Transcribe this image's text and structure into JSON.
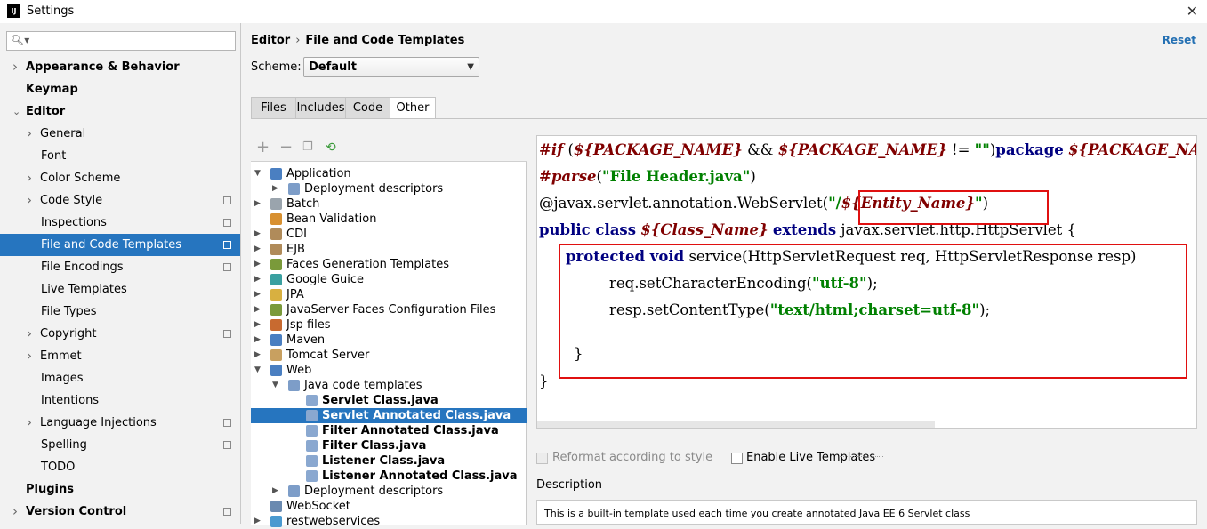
{
  "window": {
    "title": "Settings"
  },
  "search": {
    "placeholder": ""
  },
  "sidebar": {
    "items": [
      {
        "label": "Appearance & Behavior",
        "level": 0,
        "bold": true,
        "arrow": true,
        "selected": false,
        "project": false
      },
      {
        "label": "Keymap",
        "level": 0,
        "bold": true,
        "arrow": false,
        "selected": false,
        "project": false
      },
      {
        "label": "Editor",
        "level": 0,
        "bold": true,
        "arrow": true,
        "expanded": true,
        "selected": false,
        "project": false
      },
      {
        "label": "General",
        "level": 1,
        "bold": false,
        "arrow": true,
        "selected": false,
        "project": false
      },
      {
        "label": "Font",
        "level": 1,
        "bold": false,
        "arrow": false,
        "selected": false,
        "project": false
      },
      {
        "label": "Color Scheme",
        "level": 1,
        "bold": false,
        "arrow": true,
        "selected": false,
        "project": false
      },
      {
        "label": "Code Style",
        "level": 1,
        "bold": false,
        "arrow": true,
        "selected": false,
        "project": true
      },
      {
        "label": "Inspections",
        "level": 1,
        "bold": false,
        "arrow": false,
        "selected": false,
        "project": true
      },
      {
        "label": "File and Code Templates",
        "level": 1,
        "bold": false,
        "arrow": false,
        "selected": true,
        "project": true
      },
      {
        "label": "File Encodings",
        "level": 1,
        "bold": false,
        "arrow": false,
        "selected": false,
        "project": true
      },
      {
        "label": "Live Templates",
        "level": 1,
        "bold": false,
        "arrow": false,
        "selected": false,
        "project": false
      },
      {
        "label": "File Types",
        "level": 1,
        "bold": false,
        "arrow": false,
        "selected": false,
        "project": false
      },
      {
        "label": "Copyright",
        "level": 1,
        "bold": false,
        "arrow": true,
        "selected": false,
        "project": true
      },
      {
        "label": "Emmet",
        "level": 1,
        "bold": false,
        "arrow": true,
        "selected": false,
        "project": false
      },
      {
        "label": "Images",
        "level": 1,
        "bold": false,
        "arrow": false,
        "selected": false,
        "project": false
      },
      {
        "label": "Intentions",
        "level": 1,
        "bold": false,
        "arrow": false,
        "selected": false,
        "project": false
      },
      {
        "label": "Language Injections",
        "level": 1,
        "bold": false,
        "arrow": true,
        "selected": false,
        "project": true
      },
      {
        "label": "Spelling",
        "level": 1,
        "bold": false,
        "arrow": false,
        "selected": false,
        "project": true
      },
      {
        "label": "TODO",
        "level": 1,
        "bold": false,
        "arrow": false,
        "selected": false,
        "project": false
      },
      {
        "label": "Plugins",
        "level": 0,
        "bold": true,
        "arrow": false,
        "selected": false,
        "project": false
      },
      {
        "label": "Version Control",
        "level": 0,
        "bold": true,
        "arrow": true,
        "selected": false,
        "project": true
      }
    ]
  },
  "header": {
    "crumb1": "Editor",
    "crumb_sep": "›",
    "crumb2": "File and Code Templates",
    "reset": "Reset"
  },
  "scheme": {
    "label": "Scheme:",
    "value": "Default"
  },
  "tabs": [
    {
      "label": "Files",
      "active": false
    },
    {
      "label": "Includes",
      "active": false
    },
    {
      "label": "Code",
      "active": false
    },
    {
      "label": "Other",
      "active": true
    }
  ],
  "tree": {
    "items": [
      {
        "label": "Application",
        "level": 0,
        "arrow": "open",
        "icon": "#4a7fc1",
        "bold": false,
        "selected": false
      },
      {
        "label": "Deployment descriptors",
        "level": 1,
        "arrow": "closed",
        "icon": "#7d9dc8",
        "bold": false,
        "selected": false
      },
      {
        "label": "Batch",
        "level": 0,
        "arrow": "closed",
        "icon": "#9aa4ad",
        "bold": false,
        "selected": false
      },
      {
        "label": "Bean Validation",
        "level": 0,
        "arrow": "none",
        "icon": "#d89030",
        "bold": false,
        "selected": false
      },
      {
        "label": "CDI",
        "level": 0,
        "arrow": "closed",
        "icon": "#b08b5a",
        "bold": false,
        "selected": false
      },
      {
        "label": "EJB",
        "level": 0,
        "arrow": "closed",
        "icon": "#b08b5a",
        "bold": false,
        "selected": false
      },
      {
        "label": "Faces Generation Templates",
        "level": 0,
        "arrow": "closed",
        "icon": "#7a9a3a",
        "bold": false,
        "selected": false
      },
      {
        "label": "Google Guice",
        "level": 0,
        "arrow": "closed",
        "icon": "#3aa0a0",
        "bold": false,
        "selected": false
      },
      {
        "label": "JPA",
        "level": 0,
        "arrow": "closed",
        "icon": "#d8b040",
        "bold": false,
        "selected": false
      },
      {
        "label": "JavaServer Faces Configuration Files",
        "level": 0,
        "arrow": "closed",
        "icon": "#7a9a3a",
        "bold": false,
        "selected": false
      },
      {
        "label": "Jsp files",
        "level": 0,
        "arrow": "closed",
        "icon": "#c86a30",
        "bold": false,
        "selected": false
      },
      {
        "label": "Maven",
        "level": 0,
        "arrow": "closed",
        "icon": "#4a7fc1",
        "bold": false,
        "selected": false
      },
      {
        "label": "Tomcat Server",
        "level": 0,
        "arrow": "closed",
        "icon": "#c8a060",
        "bold": false,
        "selected": false
      },
      {
        "label": "Web",
        "level": 0,
        "arrow": "open",
        "icon": "#4a7fc1",
        "bold": false,
        "selected": false
      },
      {
        "label": "Java code templates",
        "level": 1,
        "arrow": "open",
        "icon": "#7d9dc8",
        "bold": false,
        "selected": false
      },
      {
        "label": "Servlet Class.java",
        "level": 2,
        "arrow": "none",
        "icon": "#8aa8d0",
        "bold": true,
        "selected": false
      },
      {
        "label": "Servlet Annotated Class.java",
        "level": 2,
        "arrow": "none",
        "icon": "#8aa8d0",
        "bold": true,
        "selected": true
      },
      {
        "label": "Filter Annotated Class.java",
        "level": 2,
        "arrow": "none",
        "icon": "#8aa8d0",
        "bold": true,
        "selected": false
      },
      {
        "label": "Filter Class.java",
        "level": 2,
        "arrow": "none",
        "icon": "#8aa8d0",
        "bold": true,
        "selected": false
      },
      {
        "label": "Listener Class.java",
        "level": 2,
        "arrow": "none",
        "icon": "#8aa8d0",
        "bold": true,
        "selected": false
      },
      {
        "label": "Listener Annotated Class.java",
        "level": 2,
        "arrow": "none",
        "icon": "#8aa8d0",
        "bold": true,
        "selected": false
      },
      {
        "label": "Deployment descriptors",
        "level": 1,
        "arrow": "closed",
        "icon": "#7d9dc8",
        "bold": false,
        "selected": false
      },
      {
        "label": "WebSocket",
        "level": 0,
        "arrow": "none",
        "icon": "#6a8ab0",
        "bold": false,
        "selected": false
      },
      {
        "label": "restwebservices",
        "level": 0,
        "arrow": "closed",
        "icon": "#4a9ad0",
        "bold": false,
        "selected": false
      }
    ]
  },
  "code": {
    "line1": {
      "dir1": "#if",
      "p1": " (",
      "v1": "${PACKAGE_NAME}",
      "p2": " && ",
      "v2": "${PACKAGE_NAME}",
      "p3": " != ",
      "s1": "\"\"",
      "p4": ")",
      "kw": "package",
      "p5": " ",
      "v3": "${PACKAGE_NAME}"
    },
    "line2": {
      "dir": "#parse",
      "p1": "(",
      "s": "\"File Header.java\"",
      "p2": ")"
    },
    "line3": {
      "p1": "@javax.servlet.annotation.WebServlet(",
      "s1": "\"/",
      "v": "${Entity_Name}",
      "s2": "\"",
      "p2": ")"
    },
    "line4": {
      "kw1": "public class",
      "p1": " ",
      "v": "${Class_Name}",
      "p2": " ",
      "kw2": "extends",
      "p3": " javax.servlet.http.HttpServlet {"
    },
    "line5": {
      "kw": "protected void",
      "p": " service(HttpServletRequest req, HttpServletResponse resp)"
    },
    "line6": {
      "p1": "req.setCharacterEncoding(",
      "s": "\"utf-8\"",
      "p2": ");"
    },
    "line7": {
      "p1": "resp.setContentType(",
      "s": "\"text/html;charset=utf-8\"",
      "p2": ");"
    },
    "line8": "}",
    "line9": "}"
  },
  "options": {
    "reformat": "Reformat according to style",
    "live_templates": "Enable Live Templates",
    "live_templates_key": "L"
  },
  "description": {
    "header": "Description",
    "text": "This is a built-in template used each time you create annotated Java EE 6 Servlet class"
  }
}
